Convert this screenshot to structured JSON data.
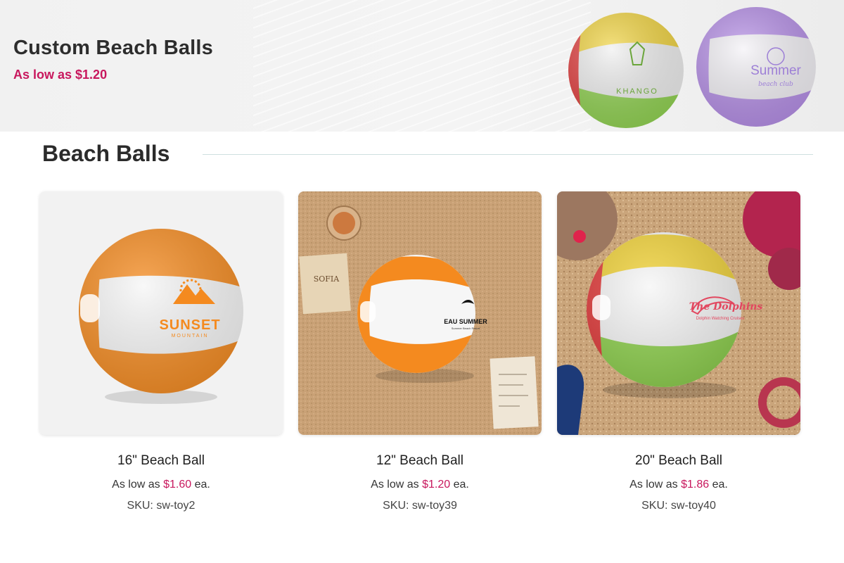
{
  "banner": {
    "title": "Custom Beach Balls",
    "price_text": "As low as $1.20",
    "ball_logos": [
      "KHANGO",
      "Summer",
      "beach club"
    ]
  },
  "section": {
    "title": "Beach Balls"
  },
  "products": [
    {
      "name": "16\" Beach Ball",
      "price_prefix": "As low as",
      "price": "$1.60",
      "price_suffix": "ea.",
      "sku": "SKU: sw-toy2",
      "logo_text": "SUNSET",
      "logo_sub": "MOUNTAIN"
    },
    {
      "name": "12\" Beach Ball",
      "price_prefix": "As low as",
      "price": "$1.20",
      "price_suffix": "ea.",
      "sku": "SKU: sw-toy39",
      "logo_text": "EAU SUMMER",
      "logo_sub": "Summer Beach Resort",
      "card_text": "SOFIA"
    },
    {
      "name": "20\" Beach Ball",
      "price_prefix": "As low as",
      "price": "$1.86",
      "price_suffix": "ea.",
      "sku": "SKU: sw-toy40",
      "logo_text": "The Dolphins",
      "logo_sub": "Dolphin Watching Cruises"
    }
  ],
  "colors": {
    "accent": "#c8175d",
    "orange": "#f48a1f",
    "yellow": "#f0d23a",
    "green": "#8fd24e",
    "red": "#e23a3a",
    "purple": "#b38be6"
  }
}
